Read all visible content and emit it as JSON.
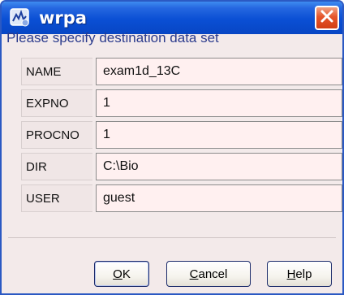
{
  "window": {
    "title": "wrpa",
    "app_icon": "bruker-topspin-icon",
    "close_icon": "close-icon"
  },
  "prompt": "Please specify destination data set",
  "fields": [
    {
      "label": "NAME",
      "value": "exam1d_13C"
    },
    {
      "label": "EXPNO",
      "value": "1"
    },
    {
      "label": "PROCNO",
      "value": "1"
    },
    {
      "label": "DIR",
      "value": "C:\\Bio"
    },
    {
      "label": "USER",
      "value": "guest"
    }
  ],
  "buttons": {
    "ok": {
      "mnemonic": "O",
      "rest": "K"
    },
    "cancel": {
      "mnemonic": "C",
      "rest": "ancel"
    },
    "help": {
      "mnemonic": "H",
      "rest": "elp"
    }
  },
  "colors": {
    "titlebar": "#0a4fd4",
    "close_button": "#e5552a",
    "dialog_background": "#f3eaea",
    "input_background": "#fff0f0",
    "prompt_text": "#2a3a8c"
  }
}
